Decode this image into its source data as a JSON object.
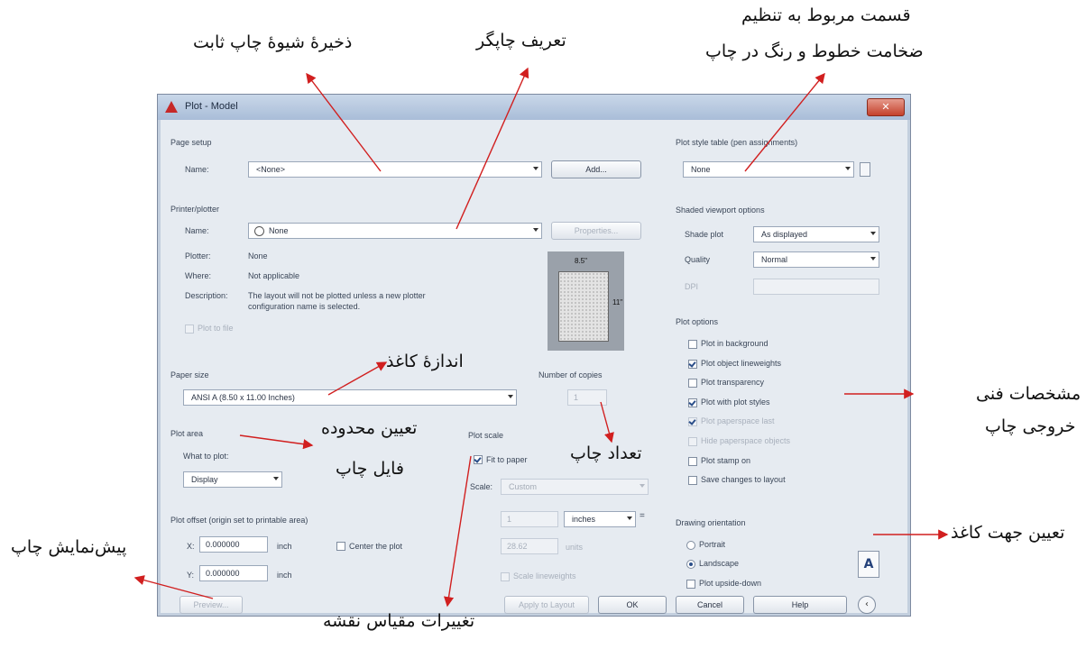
{
  "dialog": {
    "title": "Plot - Model",
    "page_setup": {
      "group": "Page setup",
      "name_label": "Name:",
      "name_value": "<None>",
      "add_label": "Add..."
    },
    "printer": {
      "group": "Printer/plotter",
      "name_label": "Name:",
      "name_value": "None",
      "properties_label": "Properties...",
      "plotter_label": "Plotter:",
      "plotter_value": "None",
      "where_label": "Where:",
      "where_value": "Not applicable",
      "description_label": "Description:",
      "description_line1": "The layout will not be plotted unless a new plotter",
      "description_line2": "configuration name is selected.",
      "plot_to_file": "Plot to file"
    },
    "preview_dims": {
      "width": "8.5\"",
      "height": "11\""
    },
    "paper_size": {
      "group": "Paper size",
      "value": "ANSI A (8.50 x 11.00 Inches)"
    },
    "copies": {
      "label": "Number of copies",
      "value": "1"
    },
    "plot_area": {
      "group": "Plot area",
      "what_label": "What to plot:",
      "what_value": "Display"
    },
    "plot_scale": {
      "group": "Plot scale",
      "fit_label": "Fit to paper",
      "scale_label": "Scale:",
      "scale_value": "Custom",
      "value1": "1",
      "unit1": "inches",
      "value2": "28.62",
      "unit2": "units",
      "lineweights": "Scale lineweights",
      "eq": "="
    },
    "plot_offset": {
      "group": "Plot offset (origin set to printable area)",
      "x_label": "X:",
      "x_value": "0.000000",
      "x_unit": "inch",
      "y_label": "Y:",
      "y_value": "0.000000",
      "y_unit": "inch",
      "center": "Center the plot"
    },
    "plot_style_table": {
      "group": "Plot style table (pen assignments)",
      "value": "None"
    },
    "shaded": {
      "group": "Shaded viewport options",
      "shade_label": "Shade plot",
      "shade_value": "As displayed",
      "quality_label": "Quality",
      "quality_value": "Normal",
      "dpi_label": "DPI"
    },
    "plot_options": {
      "group": "Plot options",
      "items": [
        {
          "label": "Plot in background",
          "checked": false,
          "enabled": true
        },
        {
          "label": "Plot object lineweights",
          "checked": true,
          "enabled": true
        },
        {
          "label": "Plot transparency",
          "checked": false,
          "enabled": true
        },
        {
          "label": "Plot with plot styles",
          "checked": true,
          "enabled": true
        },
        {
          "label": "Plot paperspace last",
          "checked": true,
          "enabled": false
        },
        {
          "label": "Hide paperspace objects",
          "checked": false,
          "enabled": false
        },
        {
          "label": "Plot stamp on",
          "checked": false,
          "enabled": true
        },
        {
          "label": "Save changes to layout",
          "checked": false,
          "enabled": true
        }
      ]
    },
    "orientation": {
      "group": "Drawing orientation",
      "portrait": "Portrait",
      "landscape": "Landscape",
      "upside": "Plot upside-down",
      "selected": "Landscape"
    },
    "footer": {
      "preview": "Preview...",
      "apply": "Apply to Layout",
      "ok": "OK",
      "cancel": "Cancel",
      "help": "Help"
    }
  },
  "annotations": {
    "save_style": "ذخیرهٔ شیوهٔ چاپ ثابت",
    "printer_def": "تعریف چاپگر",
    "pen_section_1": "قسمت مربوط به تنظیم",
    "pen_section_2": "ضخامت خطوط و رنگ در چاپ",
    "paper_size": "اندازهٔ کاغذ",
    "plot_area_1": "تعیین محدوده",
    "plot_area_2": "فایل چاپ",
    "copies": "تعداد چاپ",
    "output_specs_1": "مشخصات فنی",
    "output_specs_2": "خروجی چاپ",
    "orientation": "تعیین جهت کاغذ",
    "preview": "پیش‌نمایش چاپ",
    "scale": "تغییرات مقیاس نقشه"
  },
  "colors": {
    "arrow": "#d11f1f",
    "dialog_bg": "#e6ebf1"
  }
}
